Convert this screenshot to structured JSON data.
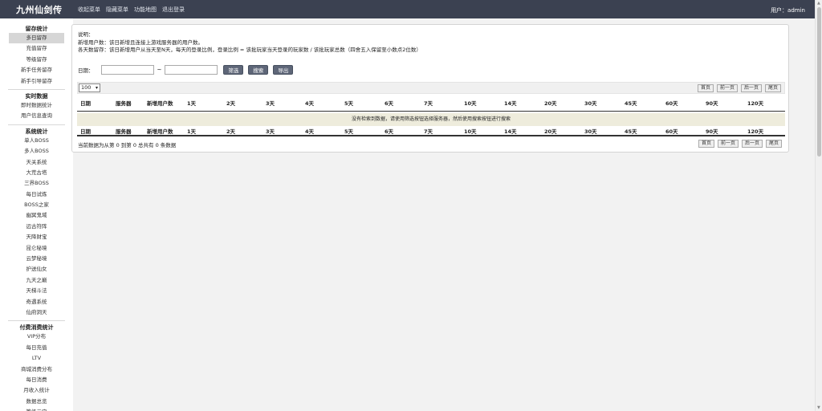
{
  "app": {
    "title": "九州仙剑传",
    "user_label": "用户：admin"
  },
  "topnav": [
    "收起菜单",
    "隐藏菜单",
    "功能地图",
    "退出登录"
  ],
  "sidebar": [
    {
      "title": "留存统计",
      "items": [
        "多日留存",
        "充值留存",
        "等级留存",
        "新手任务留存",
        "新手引导留存"
      ],
      "active": 0
    },
    {
      "title": "实时数据",
      "items": [
        "即时数据统计",
        "用户信息查询"
      ]
    },
    {
      "title": "系统统计",
      "items": [
        "单人BOSS",
        "多人BOSS",
        "天关系统",
        "大荒古塔",
        "三界BOSS",
        "每日试炼",
        "BOSS之家",
        "幽冥鬼域",
        "远古符阵",
        "天降财宝",
        "昆仑秘境",
        "云梦秘境",
        "护送仙女",
        "九天之巅",
        "天梯斗法",
        "奇遇系统",
        "仙府洞天"
      ]
    },
    {
      "title": "付费消费统计",
      "items": [
        "VIP分布",
        "每日充值",
        "LTV",
        "商城消费分布",
        "每日消费",
        "月收入统计",
        "数据总览",
        "等级元宝"
      ]
    }
  ],
  "desc": [
    "说明：",
    "新增用户数：该日新增且连接上游戏服务器的用户数。",
    "各天数留存：该日新增用户从当天至N天，每天的登录比例，登录比例 = 该批玩家当天登录的玩家数 / 该批玩家总数（四舍五入保留至小数点2位数）"
  ],
  "filter": {
    "date_label": "日期：",
    "range_sep": "~",
    "start": "",
    "end": "",
    "btn_filter": "筛选",
    "btn_search": "搜索",
    "btn_export": "导出"
  },
  "table": {
    "page_size": "100",
    "pager": [
      "首页",
      "前一页",
      "后一页",
      "尾页"
    ],
    "columns": [
      "日期",
      "服务器",
      "新增用户数",
      "1天",
      "2天",
      "3天",
      "4天",
      "5天",
      "6天",
      "7天",
      "10天",
      "14天",
      "20天",
      "30天",
      "45天",
      "60天",
      "90天",
      "120天"
    ],
    "empty_message": "没有检索到数据，请使用筛选按钮选择服务器，然后使用搜索按钮进行搜索",
    "info": "当前数据为从第 0 到第 0 总共有 0 条数据"
  }
}
